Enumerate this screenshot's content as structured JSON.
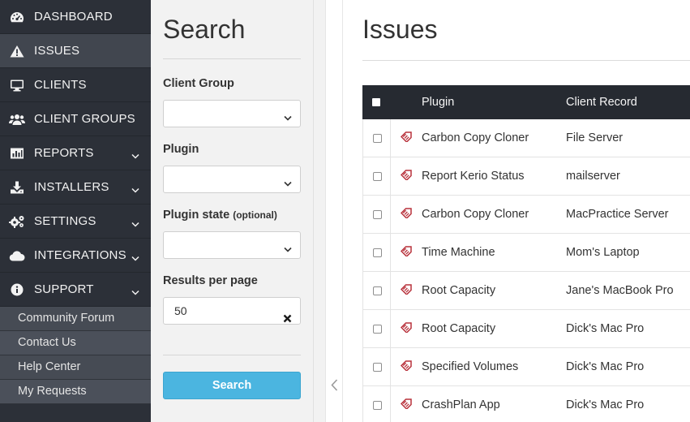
{
  "sidebar": {
    "items": [
      {
        "label": "DASHBOARD",
        "icon": "dashboard-icon",
        "active": false
      },
      {
        "label": "ISSUES",
        "icon": "warning-icon",
        "active": true
      },
      {
        "label": "CLIENTS",
        "icon": "monitor-icon",
        "active": false
      },
      {
        "label": "CLIENT GROUPS",
        "icon": "users-icon",
        "active": false
      },
      {
        "label": "REPORTS",
        "icon": "bar-chart-icon",
        "active": false
      },
      {
        "label": "INSTALLERS",
        "icon": "download-icon",
        "active": false
      },
      {
        "label": "SETTINGS",
        "icon": "gears-icon",
        "active": false
      },
      {
        "label": "INTEGRATIONS",
        "icon": "cloud-icon",
        "active": false
      },
      {
        "label": "SUPPORT",
        "icon": "info-icon",
        "active": false
      }
    ],
    "support_links": [
      "Community Forum",
      "Contact Us",
      "Help Center",
      "My Requests"
    ]
  },
  "search": {
    "title": "Search",
    "client_group_label": "Client Group",
    "plugin_label": "Plugin",
    "plugin_state_label": "Plugin state",
    "plugin_state_optional": "(optional)",
    "results_label": "Results per page",
    "results_value": "50",
    "button_label": "Search"
  },
  "main": {
    "title": "Issues",
    "columns": {
      "plugin": "Plugin",
      "client": "Client Record"
    },
    "rows": [
      {
        "plugin": "Carbon Copy Cloner",
        "client": "File Server"
      },
      {
        "plugin": "Report Kerio Status",
        "client": "mailserver"
      },
      {
        "plugin": "Carbon Copy Cloner",
        "client": "MacPractice Server"
      },
      {
        "plugin": "Time Machine",
        "client": "Mom's Laptop"
      },
      {
        "plugin": "Root Capacity",
        "client": "Jane's MacBook Pro"
      },
      {
        "plugin": "Root Capacity",
        "client": "Dick's Mac Pro"
      },
      {
        "plugin": "Specified Volumes",
        "client": "Dick's Mac Pro"
      },
      {
        "plugin": "CrashPlan App",
        "client": "Dick's Mac Pro"
      }
    ]
  },
  "colors": {
    "sidebar_bg": "#2c3038",
    "sidebar_active": "#41464f",
    "table_header": "#262a31",
    "search_button": "#4bb5e0",
    "issue_tag": "#b8323c"
  }
}
